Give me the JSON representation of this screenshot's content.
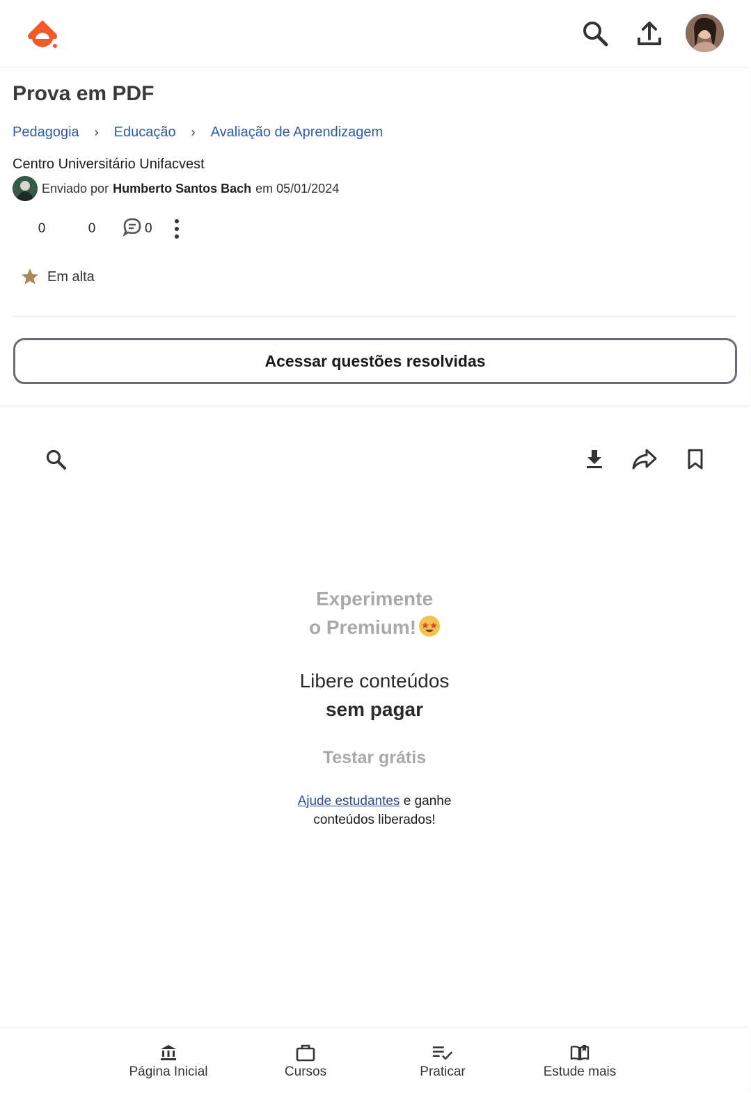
{
  "header": {
    "brand_color": "#f0592a"
  },
  "document": {
    "title": "Prova em PDF",
    "breadcrumbs": [
      "Pedagogia",
      "Educação",
      "Avaliação de Aprendizagem"
    ],
    "institution": "Centro Universitário Unifacvest",
    "uploaded_prefix": "Enviado por",
    "uploader_name": "Humberto Santos Bach",
    "uploaded_suffix": "em 05/01/2024",
    "likes": "0",
    "dislikes": "0",
    "comments": "0",
    "trending_label": "Em alta"
  },
  "cta": {
    "label": "Acessar questões resolvidas"
  },
  "promo": {
    "title_line1": "Experimente",
    "title_line2": "o Premium!",
    "sub_line1": "Libere conteúdos",
    "sub_line2": "sem pagar",
    "try_label": "Testar grátis",
    "help_link": "Ajude estudantes",
    "help_rest1": "e ganhe",
    "help_rest2": "conteúdos liberados!"
  },
  "bottom_nav": {
    "home": "Página Inicial",
    "courses": "Cursos",
    "practice": "Praticar",
    "study": "Estude mais"
  }
}
